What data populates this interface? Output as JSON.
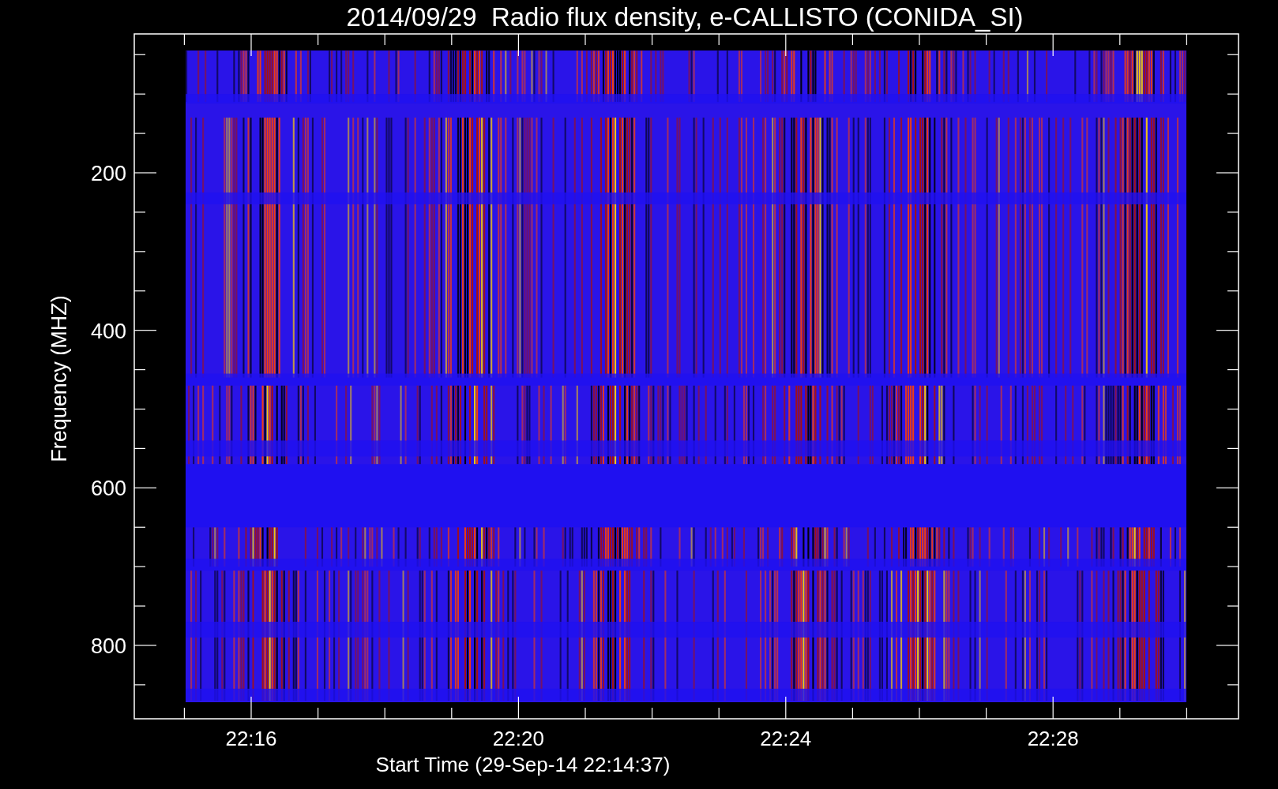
{
  "title": "2014/09/29  Radio flux density, e-CALLISTO (CONIDA_SI)",
  "ylabel": "Frequency (MHZ)",
  "xlabel": "Start Time (29-Sep-14 22:14:37)",
  "yticks": [
    "200",
    "400",
    "600",
    "800"
  ],
  "xticks": [
    "22:16",
    "22:20",
    "22:24",
    "22:28"
  ]
}
